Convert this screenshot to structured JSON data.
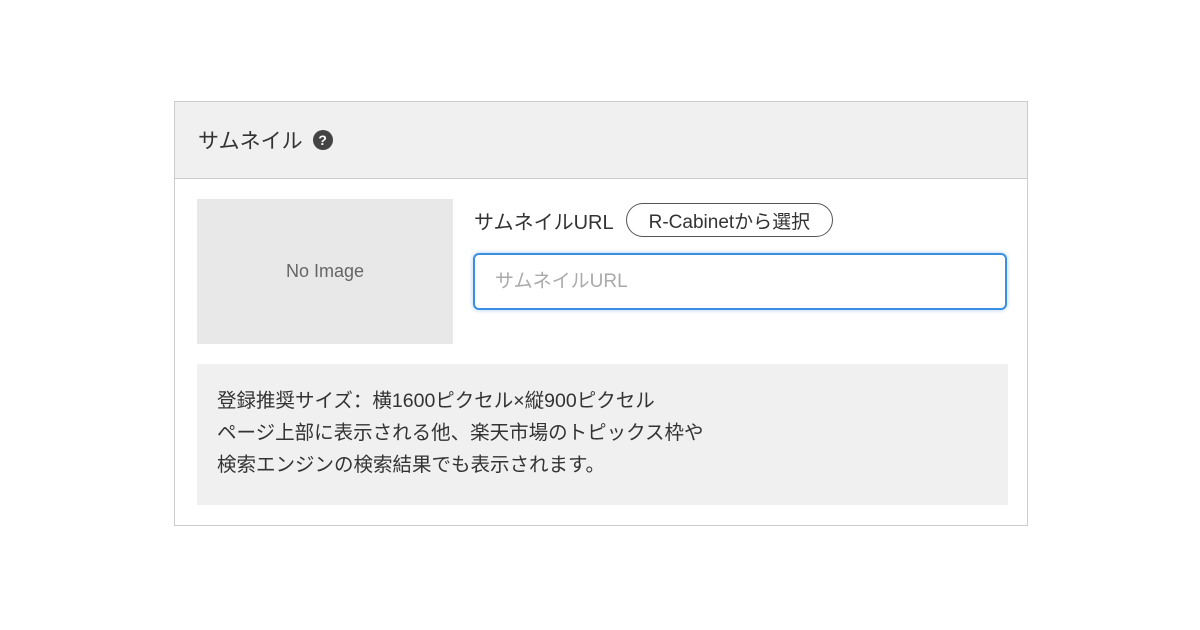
{
  "panel": {
    "title": "サムネイル",
    "help_icon": "question-circle-icon",
    "help_glyph": "?"
  },
  "thumbnail": {
    "placeholder_text": "No Image"
  },
  "url_field": {
    "label": "サムネイルURL",
    "select_button_label": "R-Cabinetから選択",
    "placeholder": "サムネイルURL",
    "value": ""
  },
  "info": {
    "lines": [
      "登録推奨サイズ：横1600ピクセル×縦900ピクセル",
      "ページ上部に表示される他、楽天市場のトピックス枠や",
      "検索エンジンの検索結果でも表示されます。"
    ]
  },
  "colors": {
    "header_bg": "#f0f0f0",
    "border": "#cccccc",
    "focus_accent": "#3b8fe0",
    "thumb_bg": "#e8e8e8",
    "info_bg": "#f0f0f0"
  }
}
